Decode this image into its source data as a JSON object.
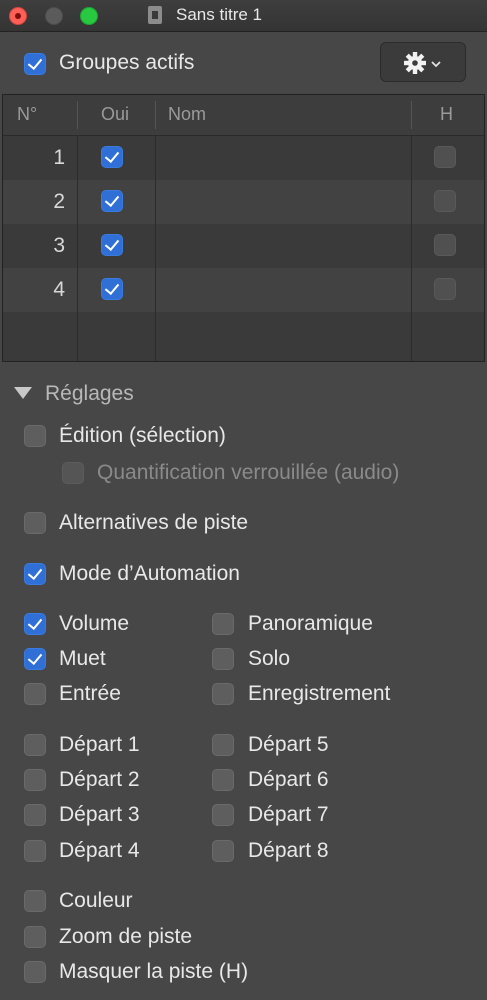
{
  "window": {
    "title": "Sans titre 1"
  },
  "groups_active": {
    "label": "Groupes actifs",
    "checked": true
  },
  "table": {
    "headers": [
      "N°",
      "Oui",
      "Nom",
      "H"
    ],
    "rows": [
      {
        "num": "1",
        "oui": true,
        "name": "",
        "h": false
      },
      {
        "num": "2",
        "oui": true,
        "name": "",
        "h": false
      },
      {
        "num": "3",
        "oui": true,
        "name": "",
        "h": false
      },
      {
        "num": "4",
        "oui": true,
        "name": "",
        "h": false
      }
    ]
  },
  "settings": {
    "title": "Réglages",
    "edit_selection": {
      "label": "Édition (sélection)",
      "checked": false
    },
    "quant_locked": {
      "label": "Quantification verrouillée (audio)",
      "checked": false,
      "disabled": true
    },
    "track_alternatives": {
      "label": "Alternatives de piste",
      "checked": false
    },
    "automation_mode": {
      "label": "Mode d’Automation",
      "checked": true
    },
    "volume": {
      "label": "Volume",
      "checked": true
    },
    "pan": {
      "label": "Panoramique",
      "checked": false
    },
    "mute": {
      "label": "Muet",
      "checked": true
    },
    "solo": {
      "label": "Solo",
      "checked": false
    },
    "input": {
      "label": "Entrée",
      "checked": false
    },
    "record": {
      "label": "Enregistrement",
      "checked": false
    },
    "sends": [
      {
        "label": "Départ 1",
        "checked": false
      },
      {
        "label": "Départ 2",
        "checked": false
      },
      {
        "label": "Départ 3",
        "checked": false
      },
      {
        "label": "Départ 4",
        "checked": false
      },
      {
        "label": "Départ 5",
        "checked": false
      },
      {
        "label": "Départ 6",
        "checked": false
      },
      {
        "label": "Départ 7",
        "checked": false
      },
      {
        "label": "Départ 8",
        "checked": false
      }
    ],
    "color": {
      "label": "Couleur",
      "checked": false
    },
    "track_zoom": {
      "label": "Zoom de piste",
      "checked": false
    },
    "hide_track": {
      "label": "Masquer la piste (H)",
      "checked": false
    }
  },
  "icons": {
    "gear": "gear-icon",
    "chevron": "chevron-down-icon",
    "disclosure": "disclosure-triangle-icon"
  }
}
